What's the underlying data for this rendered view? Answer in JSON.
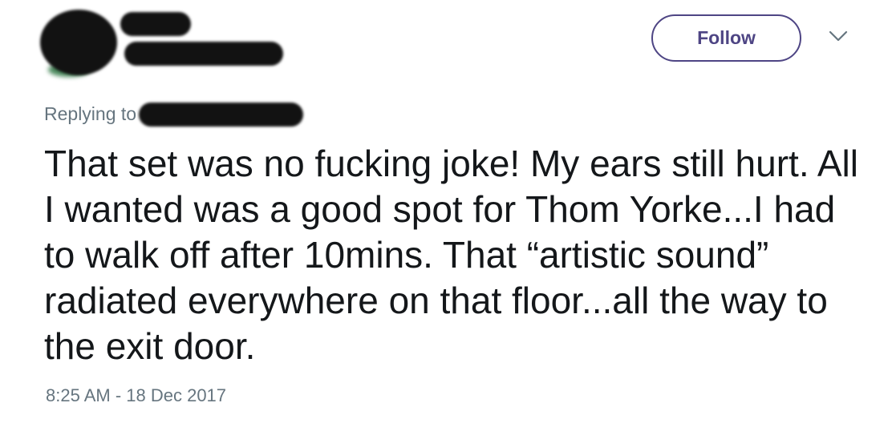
{
  "author": {
    "display_name": "",
    "handle": "",
    "avatar": "redacted-avatar"
  },
  "actions": {
    "follow_label": "Follow",
    "more_icon": "chevron-down-icon"
  },
  "reply": {
    "prefix": "Replying to",
    "handle": ""
  },
  "tweet": {
    "text": "That set was no fucking joke! My ears still hurt. All I wanted was a good spot for Thom Yorke...I had to walk off after 10mins. That “artistic sound” radiated everywhere on that floor...all the way to the exit door.",
    "timestamp": "8:25 AM - 18 Dec 2017"
  },
  "colors": {
    "accent": "#4e4584",
    "muted": "#66757f",
    "text": "#14171a",
    "redaction": "#121212"
  }
}
